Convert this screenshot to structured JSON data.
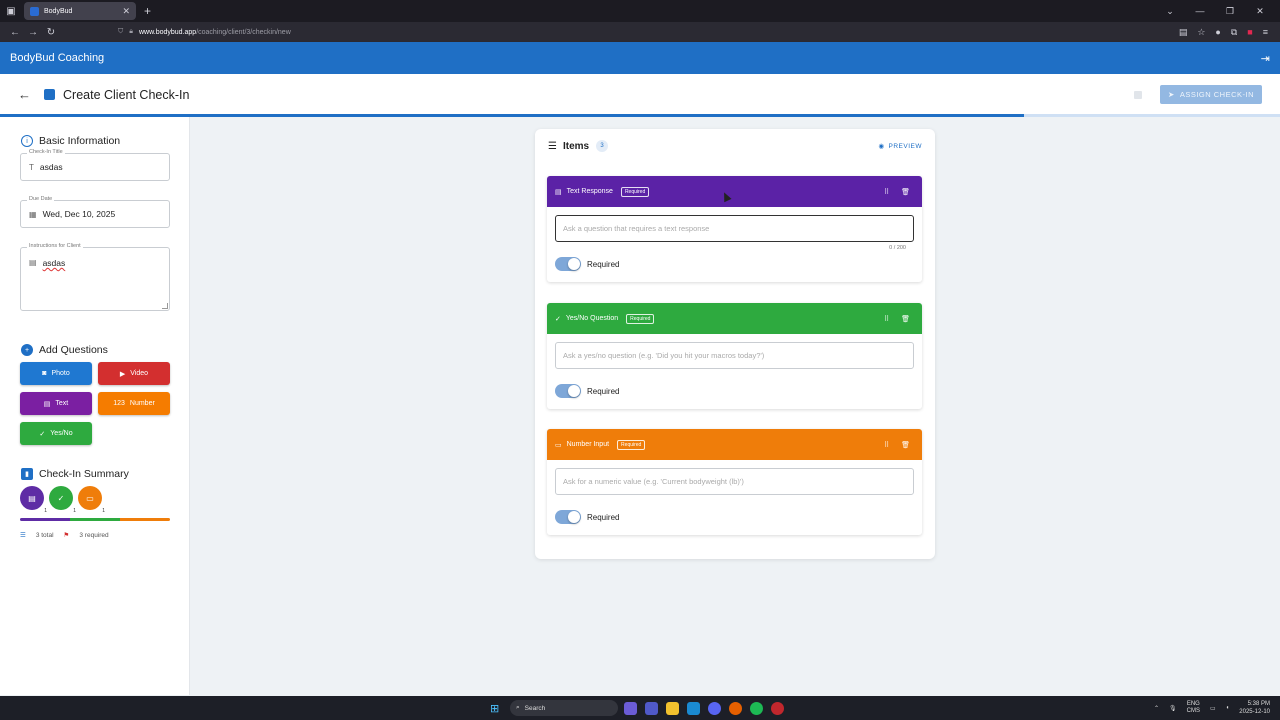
{
  "browser": {
    "tab_title": "BodyBud",
    "url_host": "www.bodybud.app",
    "url_path": "/coaching/client/3/checkin/new"
  },
  "app": {
    "title": "BodyBud Coaching"
  },
  "header": {
    "title": "Create Client Check-In",
    "assign_label": "ASSIGN CHECK-IN",
    "progress_percent": 80
  },
  "basic_info": {
    "heading": "Basic Information",
    "title_label": "Check-In Title",
    "title_value": "asdas",
    "due_label": "Due Date",
    "due_value": "Wed, Dec 10, 2025",
    "instructions_label": "Instructions for Client",
    "instructions_value": "asdas"
  },
  "add_questions": {
    "heading": "Add Questions",
    "buttons": [
      {
        "label": "Photo",
        "color": "#1f78d1",
        "icon": "camera-icon"
      },
      {
        "label": "Video",
        "color": "#d32f2f",
        "icon": "video-icon"
      },
      {
        "label": "Text",
        "color": "#7b1fa2",
        "icon": "text-icon"
      },
      {
        "label": "Number",
        "color": "#f57c00",
        "icon": "number-icon"
      },
      {
        "label": "Yes/No",
        "color": "#2eaa3f",
        "icon": "check-circle-icon"
      }
    ]
  },
  "summary": {
    "heading": "Check-In Summary",
    "types": [
      {
        "count": "1",
        "color": "#5e2ca5",
        "icon": "text-icon"
      },
      {
        "count": "1",
        "color": "#2eaa3f",
        "icon": "check-circle-icon"
      },
      {
        "count": "1",
        "color": "#ef7d0a",
        "icon": "number-icon"
      }
    ],
    "total_text": "3 total",
    "required_text": "3 required"
  },
  "items": {
    "title": "Items",
    "count": "3",
    "preview_label": "PREVIEW",
    "questions": [
      {
        "type_label": "Text Response",
        "badge": "Required",
        "color": "#5b22a6",
        "placeholder": "Ask a question that requires a text response",
        "char_count": "0 / 200",
        "toggle_label": "Required",
        "required": true
      },
      {
        "type_label": "Yes/No Question",
        "badge": "Required",
        "color": "#2eaa3f",
        "placeholder": "Ask a yes/no question (e.g. 'Did you hit your macros today?')",
        "char_count": "",
        "toggle_label": "Required",
        "required": true
      },
      {
        "type_label": "Number Input",
        "badge": "Required",
        "color": "#ef7d0a",
        "placeholder": "Ask for a numeric value (e.g. 'Current bodyweight (lb)')",
        "char_count": "",
        "toggle_label": "Required",
        "required": true
      }
    ]
  },
  "taskbar": {
    "search_label": "Search",
    "lang_top": "ENG",
    "lang_bottom": "CMS",
    "time": "5:38 PM",
    "date": "2025-12-10"
  }
}
